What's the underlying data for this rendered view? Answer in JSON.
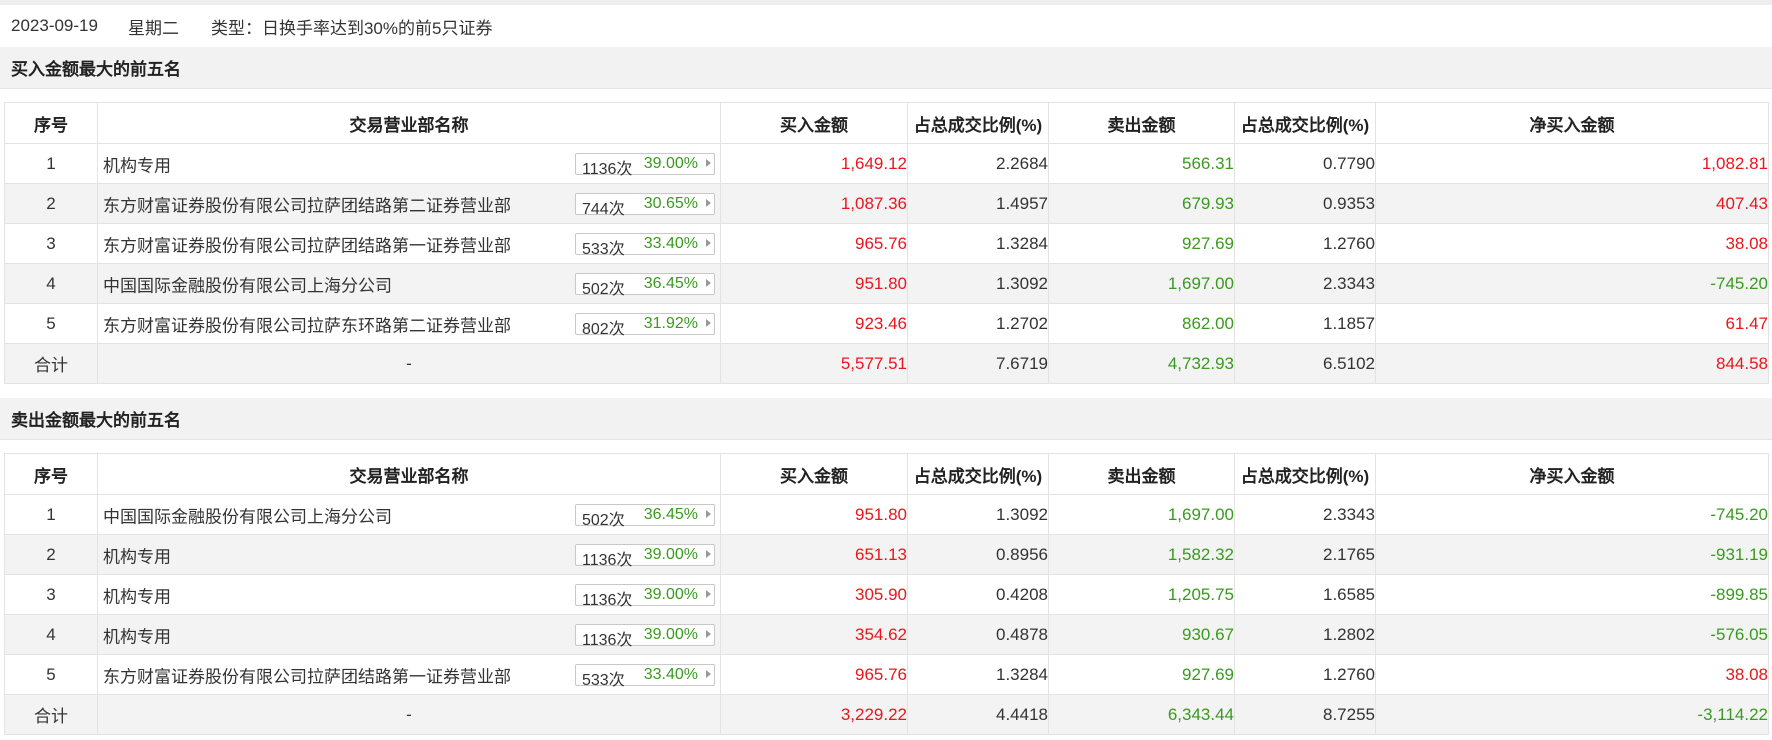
{
  "info": {
    "date": "2023-09-19",
    "weekday": "星期二",
    "type": "类型：日换手率达到30%的前5只证券"
  },
  "colors": {
    "up": "#e8171c",
    "down": "#3a9a1f"
  },
  "headers": [
    "序号",
    "交易营业部名称",
    "买入金额",
    "占总成交比例(%)",
    "卖出金额",
    "占总成交比例(%)",
    "净买入金额"
  ],
  "buy_section": {
    "title": "买入金额最大的前五名",
    "rows": [
      {
        "no": "1",
        "name": "机构专用",
        "count": "1136次",
        "rate": "39.00%",
        "buy": "1,649.12",
        "buy_pct": "2.2684",
        "sell": "566.31",
        "sell_pct": "0.7790",
        "net": "1,082.81",
        "net_color": "red"
      },
      {
        "no": "2",
        "name": "东方财富证券股份有限公司拉萨团结路第二证券营业部",
        "count": "744次",
        "rate": "30.65%",
        "buy": "1,087.36",
        "buy_pct": "1.4957",
        "sell": "679.93",
        "sell_pct": "0.9353",
        "net": "407.43",
        "net_color": "red"
      },
      {
        "no": "3",
        "name": "东方财富证券股份有限公司拉萨团结路第一证券营业部",
        "count": "533次",
        "rate": "33.40%",
        "buy": "965.76",
        "buy_pct": "1.3284",
        "sell": "927.69",
        "sell_pct": "1.2760",
        "net": "38.08",
        "net_color": "red"
      },
      {
        "no": "4",
        "name": "中国国际金融股份有限公司上海分公司",
        "count": "502次",
        "rate": "36.45%",
        "buy": "951.80",
        "buy_pct": "1.3092",
        "sell": "1,697.00",
        "sell_pct": "2.3343",
        "net": "-745.20",
        "net_color": "green"
      },
      {
        "no": "5",
        "name": "东方财富证券股份有限公司拉萨东环路第二证券营业部",
        "count": "802次",
        "rate": "31.92%",
        "buy": "923.46",
        "buy_pct": "1.2702",
        "sell": "862.00",
        "sell_pct": "1.1857",
        "net": "61.47",
        "net_color": "red"
      }
    ],
    "total": {
      "label": "合计",
      "name": "-",
      "buy": "5,577.51",
      "buy_pct": "7.6719",
      "sell": "4,732.93",
      "sell_pct": "6.5102",
      "net": "844.58",
      "net_color": "red"
    }
  },
  "sell_section": {
    "title": "卖出金额最大的前五名",
    "rows": [
      {
        "no": "1",
        "name": "中国国际金融股份有限公司上海分公司",
        "count": "502次",
        "rate": "36.45%",
        "buy": "951.80",
        "buy_pct": "1.3092",
        "sell": "1,697.00",
        "sell_pct": "2.3343",
        "net": "-745.20",
        "net_color": "green"
      },
      {
        "no": "2",
        "name": "机构专用",
        "count": "1136次",
        "rate": "39.00%",
        "buy": "651.13",
        "buy_pct": "0.8956",
        "sell": "1,582.32",
        "sell_pct": "2.1765",
        "net": "-931.19",
        "net_color": "green"
      },
      {
        "no": "3",
        "name": "机构专用",
        "count": "1136次",
        "rate": "39.00%",
        "buy": "305.90",
        "buy_pct": "0.4208",
        "sell": "1,205.75",
        "sell_pct": "1.6585",
        "net": "-899.85",
        "net_color": "green"
      },
      {
        "no": "4",
        "name": "机构专用",
        "count": "1136次",
        "rate": "39.00%",
        "buy": "354.62",
        "buy_pct": "0.4878",
        "sell": "930.67",
        "sell_pct": "1.2802",
        "net": "-576.05",
        "net_color": "green"
      },
      {
        "no": "5",
        "name": "东方财富证券股份有限公司拉萨团结路第一证券营业部",
        "count": "533次",
        "rate": "33.40%",
        "buy": "965.76",
        "buy_pct": "1.3284",
        "sell": "927.69",
        "sell_pct": "1.2760",
        "net": "38.08",
        "net_color": "red"
      }
    ],
    "total": {
      "label": "合计",
      "name": "-",
      "buy": "3,229.22",
      "buy_pct": "4.4418",
      "sell": "6,343.44",
      "sell_pct": "8.7255",
      "net": "-3,114.22",
      "net_color": "green"
    }
  }
}
